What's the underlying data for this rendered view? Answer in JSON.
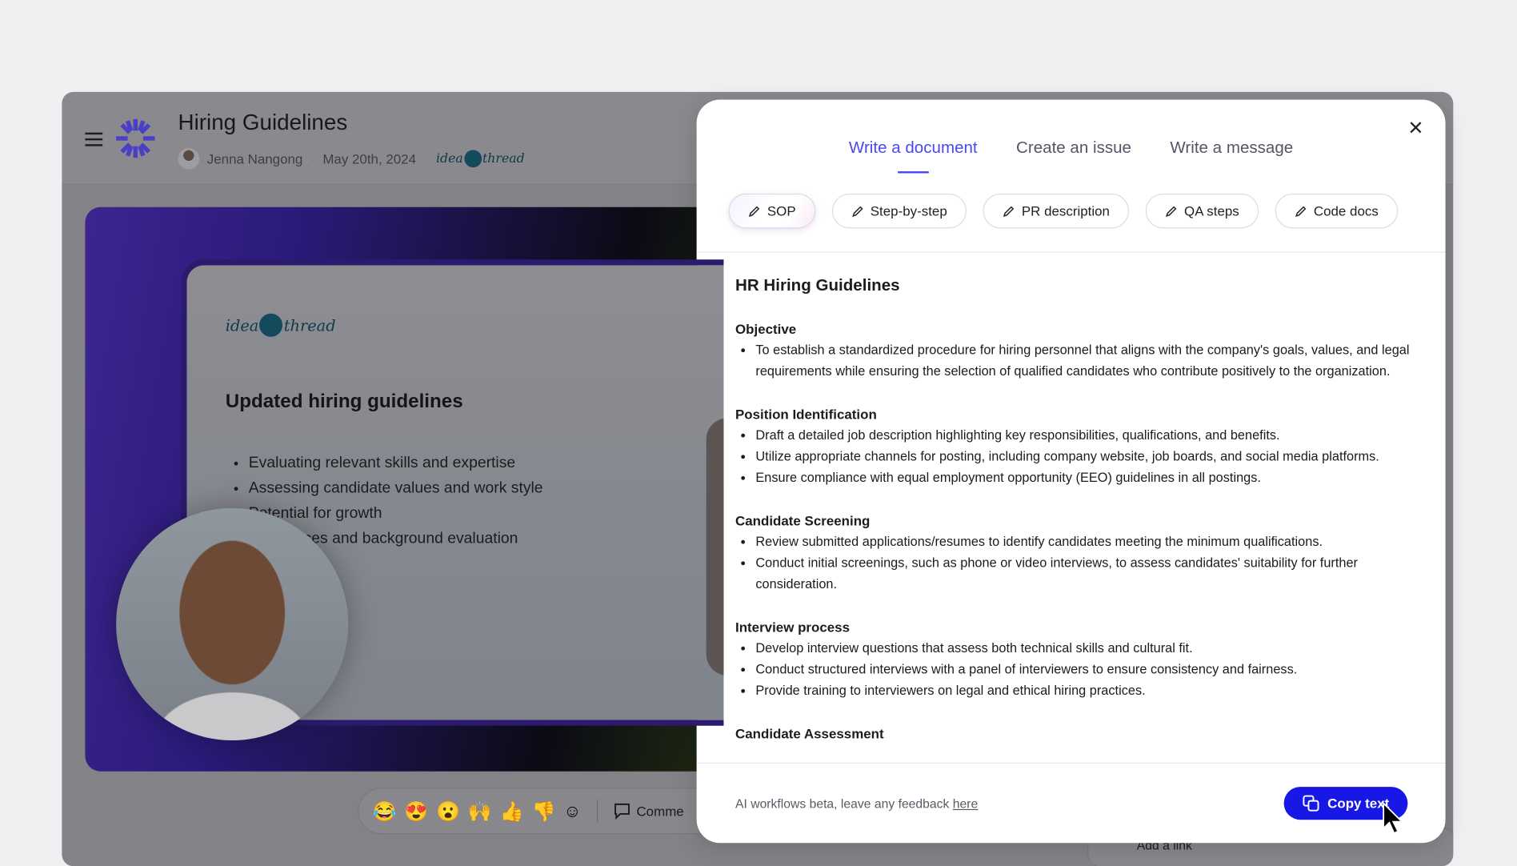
{
  "app": {
    "title": "Hiring Guidelines",
    "author": "Jenna Nangong",
    "date": "May 20th, 2024",
    "brand_logo": "ideathread",
    "accent": "#4b3fc6"
  },
  "slide": {
    "logo": "ideathread",
    "heading": "Updated hiring guidelines",
    "bullets": [
      "Evaluating relevant skills and expertise",
      "Assessing candidate values and work style",
      "Potential for growth",
      "References and background evaluation"
    ],
    "bullets_visible": [
      "Evaluating relevant skills and expertise",
      "Assessing candidate values and work style",
      "tential for growth",
      "s and background evaluation"
    ]
  },
  "reactions": {
    "emojis": [
      "😂",
      "😍",
      "😮",
      "🙌",
      "👍",
      "👎"
    ],
    "comment_label": "Comme"
  },
  "behind_panel": {
    "item": "Add a link"
  },
  "modal": {
    "tabs": [
      {
        "label": "Write a document",
        "active": true
      },
      {
        "label": "Create an issue",
        "active": false
      },
      {
        "label": "Write a message",
        "active": false
      }
    ],
    "chips": [
      {
        "label": "SOP",
        "active": true
      },
      {
        "label": "Step-by-step",
        "active": false
      },
      {
        "label": "PR description",
        "active": false
      },
      {
        "label": "QA steps",
        "active": false
      },
      {
        "label": "Code docs",
        "active": false
      }
    ],
    "document": {
      "title": "HR Hiring Guidelines",
      "sections": [
        {
          "heading": "Objective",
          "items": [
            "To establish a standardized procedure for hiring personnel that aligns with the company's goals, values, and legal requirements while ensuring the selection of qualified candidates who contribute positively to the organization."
          ]
        },
        {
          "heading": "Position Identification",
          "items": [
            "Draft a detailed job description highlighting key responsibilities, qualifications, and benefits.",
            "Utilize appropriate channels for posting, including company website, job boards, and social media platforms.",
            "Ensure compliance with equal employment opportunity (EEO) guidelines in all postings."
          ]
        },
        {
          "heading": "Candidate Screening",
          "items": [
            "Review submitted applications/resumes to identify candidates meeting the minimum qualifications.",
            "Conduct initial screenings, such as phone or video interviews, to assess candidates' suitability for further consideration."
          ]
        },
        {
          "heading": "Interview process",
          "items": [
            "Develop interview questions that assess both technical skills and cultural fit.",
            "Conduct structured interviews with a panel of interviewers to ensure consistency and fairness.",
            "Provide training to interviewers on legal and ethical hiring practices."
          ]
        },
        {
          "heading": "Candidate Assessment",
          "items": []
        }
      ]
    },
    "footer": {
      "text": "AI workflows beta, leave any feedback ",
      "link": "here",
      "copy_label": "Copy text",
      "copy_color": "#1717e6"
    },
    "tab_active_color": "#4a48f0"
  }
}
